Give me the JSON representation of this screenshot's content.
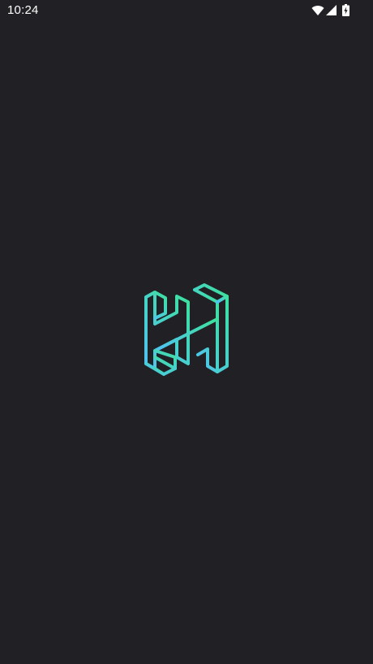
{
  "status_bar": {
    "time": "10:24",
    "icons": [
      "wifi-icon",
      "cellular-signal-icon",
      "battery-charging-icon"
    ]
  },
  "splash": {
    "logo": "app-logo-h",
    "colors": {
      "background": "#212125",
      "logo_gradient_top": "#3EE0A0",
      "logo_gradient_bottom": "#4FC3F0"
    }
  }
}
